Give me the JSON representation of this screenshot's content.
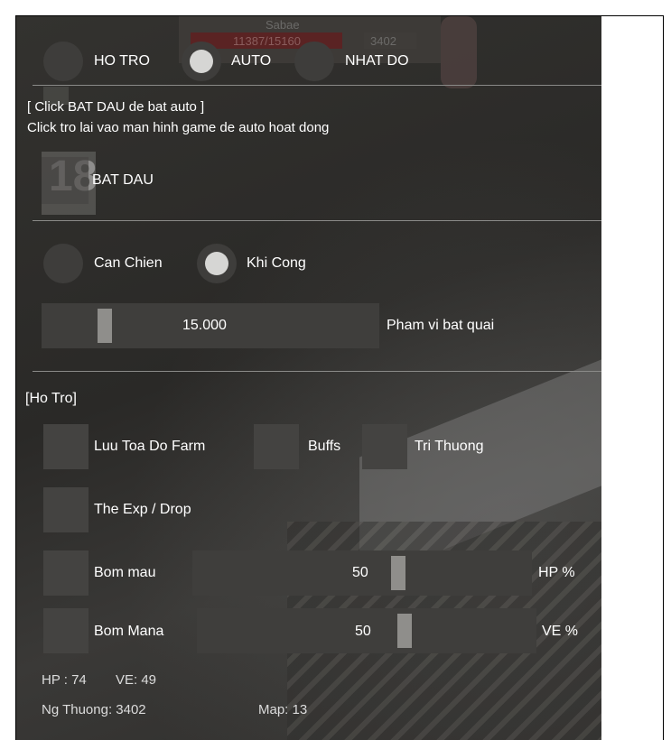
{
  "game_overlay": {
    "bar_value": "11387/15160",
    "bar_value2": "3402",
    "name": "Sabae"
  },
  "tabs": [
    {
      "label": "HO TRO",
      "selected": false
    },
    {
      "label": "AUTO",
      "selected": true
    },
    {
      "label": "NHAT DO",
      "selected": false
    }
  ],
  "auto": {
    "hint_line1": "[ Click BAT DAU de bat auto ]",
    "hint_line2": "Click tro lai vao man hinh game de auto hoat dong",
    "start_button": "BAT DAU",
    "level_badge": "18"
  },
  "combat_mode": {
    "options": [
      {
        "label": "Can Chien",
        "selected": false
      },
      {
        "label": "Khi Cong",
        "selected": true
      }
    ]
  },
  "range": {
    "value": "15.000",
    "label": "Pham vi bat quai",
    "fraction": 0.2
  },
  "support": {
    "title": "[Ho Tro]",
    "checks": [
      {
        "label": "Luu Toa Do Farm",
        "checked": false
      },
      {
        "label": "Buffs",
        "checked": false
      },
      {
        "label": "Tri Thuong",
        "checked": false
      },
      {
        "label": "The Exp / Drop",
        "checked": false
      }
    ],
    "hp_potion": {
      "label": "Bom mau",
      "value": "50",
      "unit": "HP %",
      "fraction": 0.5
    },
    "mana_potion": {
      "label": "Bom Mana",
      "value": "50",
      "unit": "VE %",
      "fraction": 0.5
    }
  },
  "status": {
    "hp": "HP : 74",
    "ve": "VE: 49",
    "ng_thuong": "Ng Thuong: 3402",
    "map": "Map: 13"
  }
}
